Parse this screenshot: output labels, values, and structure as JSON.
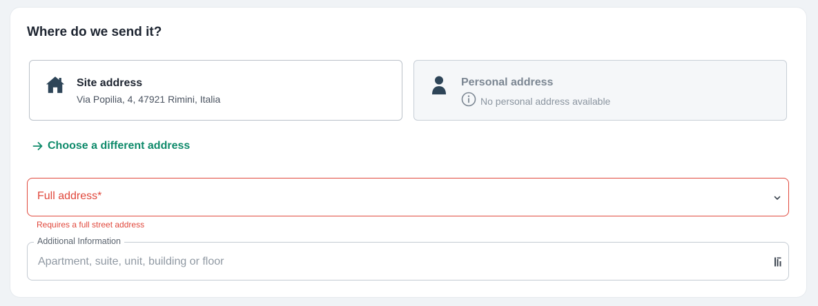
{
  "section": {
    "title": "Where do we send it?"
  },
  "site_address": {
    "title": "Site address",
    "address": "Via Popilia, 4, 47921 Rimini, Italia",
    "icon": "house-icon"
  },
  "personal_address": {
    "title": "Personal address",
    "note": "No personal address available",
    "icon": "person-icon"
  },
  "choose_link": {
    "label": "Choose a different address",
    "icon": "arrow-right-icon"
  },
  "full_address": {
    "placeholder": "Full address*",
    "error": "Requires a full street address"
  },
  "additional_info": {
    "label": "Additional Information",
    "placeholder": "Apartment, suite, unit, building or floor"
  },
  "colors": {
    "accent": "#0e8a6a",
    "error": "#e0463a",
    "icon_dark": "#2e4558"
  }
}
